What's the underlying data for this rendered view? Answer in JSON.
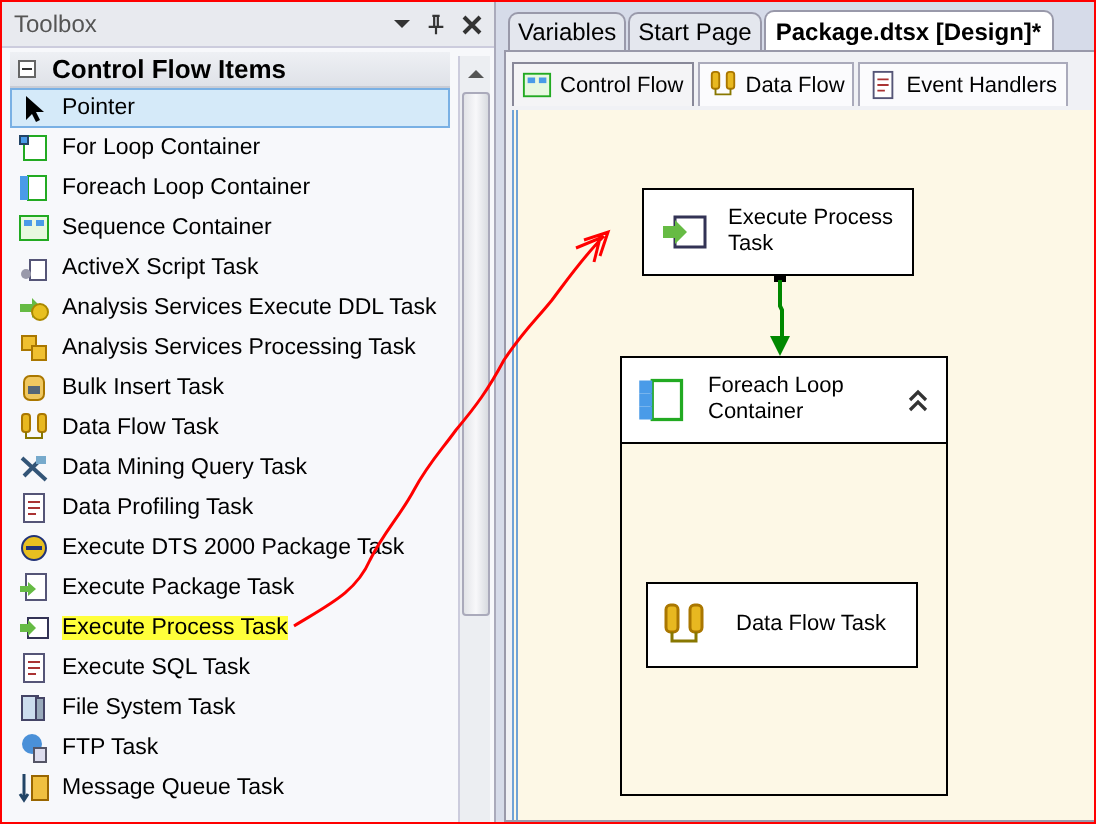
{
  "toolbox": {
    "title": "Toolbox",
    "category": {
      "label": "Control Flow Items",
      "expanded": true
    },
    "items": [
      {
        "label": "Pointer",
        "kind": "pointer",
        "selected": true,
        "highlighted": false
      },
      {
        "label": "For Loop Container",
        "kind": "loop",
        "selected": false,
        "highlighted": false
      },
      {
        "label": "Foreach Loop Container",
        "kind": "foreach",
        "selected": false,
        "highlighted": false
      },
      {
        "label": "Sequence Container",
        "kind": "sequence",
        "selected": false,
        "highlighted": false
      },
      {
        "label": "ActiveX Script Task",
        "kind": "script",
        "selected": false,
        "highlighted": false
      },
      {
        "label": "Analysis Services Execute DDL Task",
        "kind": "ddl",
        "selected": false,
        "highlighted": false
      },
      {
        "label": "Analysis Services Processing Task",
        "kind": "cube",
        "selected": false,
        "highlighted": false
      },
      {
        "label": "Bulk Insert Task",
        "kind": "bulk",
        "selected": false,
        "highlighted": false
      },
      {
        "label": "Data Flow Task",
        "kind": "dataflow",
        "selected": false,
        "highlighted": false
      },
      {
        "label": "Data Mining Query Task",
        "kind": "mining",
        "selected": false,
        "highlighted": false
      },
      {
        "label": "Data Profiling Task",
        "kind": "doc",
        "selected": false,
        "highlighted": false
      },
      {
        "label": "Execute DTS 2000 Package Task",
        "kind": "dts",
        "selected": false,
        "highlighted": false
      },
      {
        "label": "Execute Package Task",
        "kind": "package",
        "selected": false,
        "highlighted": false
      },
      {
        "label": "Execute Process Task",
        "kind": "process",
        "selected": false,
        "highlighted": true
      },
      {
        "label": "Execute SQL Task",
        "kind": "doc",
        "selected": false,
        "highlighted": false
      },
      {
        "label": "File System Task",
        "kind": "files",
        "selected": false,
        "highlighted": false
      },
      {
        "label": "FTP Task",
        "kind": "ftp",
        "selected": false,
        "highlighted": false
      },
      {
        "label": "Message Queue Task",
        "kind": "queue",
        "selected": false,
        "highlighted": false
      }
    ]
  },
  "document_tabs": [
    {
      "label": "Variables",
      "selected": false
    },
    {
      "label": "Start Page",
      "selected": false
    },
    {
      "label": "Package.dtsx [Design]*",
      "selected": true
    }
  ],
  "designer_tabs": [
    {
      "label": "Control Flow",
      "kind": "control",
      "selected": true
    },
    {
      "label": "Data Flow",
      "kind": "dataflow",
      "selected": false
    },
    {
      "label": "Event Handlers",
      "kind": "events",
      "selected": false
    }
  ],
  "canvas": {
    "tasks": [
      {
        "label": "Execute Process Task",
        "kind": "process"
      }
    ],
    "container": {
      "label": "Foreach Loop Container",
      "expanded": true,
      "tasks": [
        {
          "label": "Data Flow Task",
          "kind": "dataflow"
        }
      ]
    }
  }
}
